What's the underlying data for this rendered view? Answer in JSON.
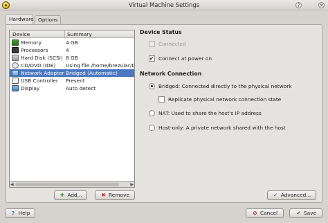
{
  "window": {
    "title": "Virtual Machine Settings",
    "help_glyph": "?",
    "close_glyph": "✕"
  },
  "tabs": [
    {
      "label": "Hardware",
      "active": true
    },
    {
      "label": "Options",
      "active": false
    }
  ],
  "devices": {
    "headers": {
      "device": "Device",
      "summary": "Summary"
    },
    "rows": [
      {
        "icon": "memory-icon",
        "name": "Memory",
        "summary": "4 GB",
        "selected": false
      },
      {
        "icon": "processor-icon",
        "name": "Processors",
        "summary": "4",
        "selected": false
      },
      {
        "icon": "hard-disk-icon",
        "name": "Hard Disk (SCSI)",
        "summary": "8 GB",
        "selected": false
      },
      {
        "icon": "cd-dvd-icon",
        "name": "CD/DVD (IDE)",
        "summary": "Using file /home/brezular/Do",
        "selected": false
      },
      {
        "icon": "network-adapter-icon",
        "name": "Network Adapter",
        "summary": "Bridged (Automatic)",
        "selected": true
      },
      {
        "icon": "usb-controller-icon",
        "name": "USB Controller",
        "summary": "Present",
        "selected": false
      },
      {
        "icon": "display-icon",
        "name": "Display",
        "summary": "Auto detect",
        "selected": false
      }
    ]
  },
  "buttons": {
    "add": "Add...",
    "remove": "Remove",
    "advanced": "Advanced...",
    "help": "Help",
    "cancel": "Cancel",
    "ok": "Save"
  },
  "device_status": {
    "title": "Device Status",
    "connected": {
      "label": "Connected",
      "checked": false,
      "enabled": false
    },
    "connect_at_power_on": {
      "label": "Connect at power on",
      "checked": true,
      "enabled": true
    }
  },
  "network_connection": {
    "title": "Network Connection",
    "bridged": {
      "label": "Bridged: Connected directly to the physical network",
      "selected": true
    },
    "replicate": {
      "label": "Replicate physical network connection state",
      "checked": false
    },
    "nat": {
      "label": "NAT: Used to share the host's IP address",
      "selected": false
    },
    "host_only": {
      "label": "Host-only: A private network shared with the host",
      "selected": false
    }
  },
  "colors": {
    "selection": "#4a78c2",
    "background": "#d6d3cf"
  }
}
